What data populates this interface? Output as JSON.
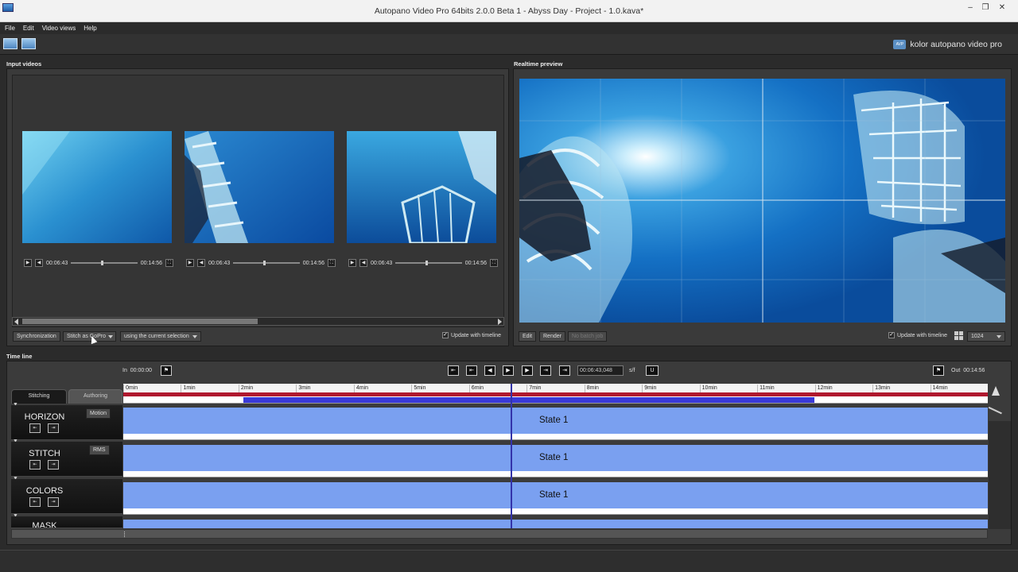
{
  "window": {
    "title": "Autopano Video Pro 64bits 2.0.0 Beta 1 - Abyss Day - Project - 1.0.kava*",
    "minimize": "–",
    "restore": "❐",
    "close": "✕"
  },
  "menu": [
    "File",
    "Edit",
    "Video views",
    "Help"
  ],
  "brand": {
    "logo_text": "AVP",
    "name": "kolor autopano video pro"
  },
  "input_videos": {
    "title": "Input videos",
    "players": [
      {
        "start": "00:06:43",
        "end": "00:14:56"
      },
      {
        "start": "00:06:43",
        "end": "00:14:56"
      },
      {
        "start": "00:06:43",
        "end": "00:14:56"
      }
    ],
    "sync_button": "Synchronization",
    "stitch_button": "Stitch  as GoPro",
    "selection_dropdown": "using the current selection",
    "update_with_timeline": "Update with timeline",
    "update_checked": "✓"
  },
  "preview": {
    "title": "Realtime preview",
    "edit_button": "Edit",
    "render_button": "Render",
    "batch_button": "No batch job",
    "update_with_timeline": "Update with timeline",
    "update_checked": "✓",
    "resolution": "1024"
  },
  "timeline": {
    "title": "Time line",
    "in_label": "In",
    "in_time": "00:00:00",
    "out_label": "Out",
    "out_time": "00:14:56",
    "current_time": "00:06:43,048",
    "fps_label": "s/f",
    "tabs": [
      "Stitching",
      "Authoring"
    ],
    "ruler": [
      "0min",
      "1min",
      "2min",
      "3min",
      "4min",
      "5min",
      "6min",
      "7min",
      "8min",
      "9min",
      "10min",
      "11min",
      "12min",
      "13min",
      "14min"
    ],
    "tracks": [
      {
        "name": "HORIZON",
        "button": "Motion",
        "state": "State 1"
      },
      {
        "name": "STITCH",
        "button": "RMS",
        "state": "State 1"
      },
      {
        "name": "COLORS",
        "button": "",
        "state": "State 1"
      },
      {
        "name": "MASK",
        "button": "",
        "state": ""
      }
    ],
    "playhead_fraction": 0.448
  },
  "colors": {
    "track_blue": "#7aa0f0",
    "range_red": "#b0182e",
    "selection_blue": "#3a3ad8",
    "playhead": "#3333aa"
  }
}
